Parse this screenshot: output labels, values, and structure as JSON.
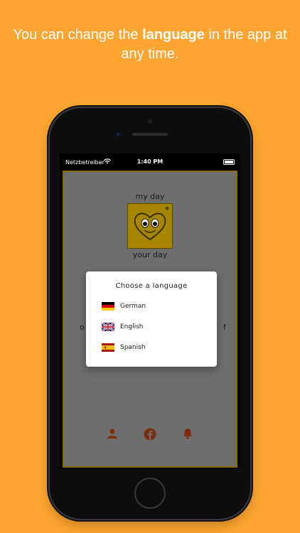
{
  "headline": {
    "before": "You can change the ",
    "bold": "language",
    "after": " in the app at any time."
  },
  "status_bar": {
    "carrier": "Netzbetreiber",
    "time": "1:40 PM"
  },
  "app": {
    "top_text": "my day",
    "bottom_text": "your day",
    "left_fragment": "o",
    "right_fragment": "f"
  },
  "dialog": {
    "title": "Choose a language",
    "options": [
      {
        "label": "German",
        "flag": "german-flag-icon"
      },
      {
        "label": "English",
        "flag": "uk-flag-icon"
      },
      {
        "label": "Spanish",
        "flag": "spanish-flag-icon"
      }
    ]
  },
  "bottom_nav": [
    "person-icon",
    "facebook-icon",
    "bell-icon"
  ],
  "colors": {
    "background": "#FDA530",
    "app_border": "#8a6c00",
    "logo": "#a88600",
    "nav_icons": "#7a2e10"
  }
}
